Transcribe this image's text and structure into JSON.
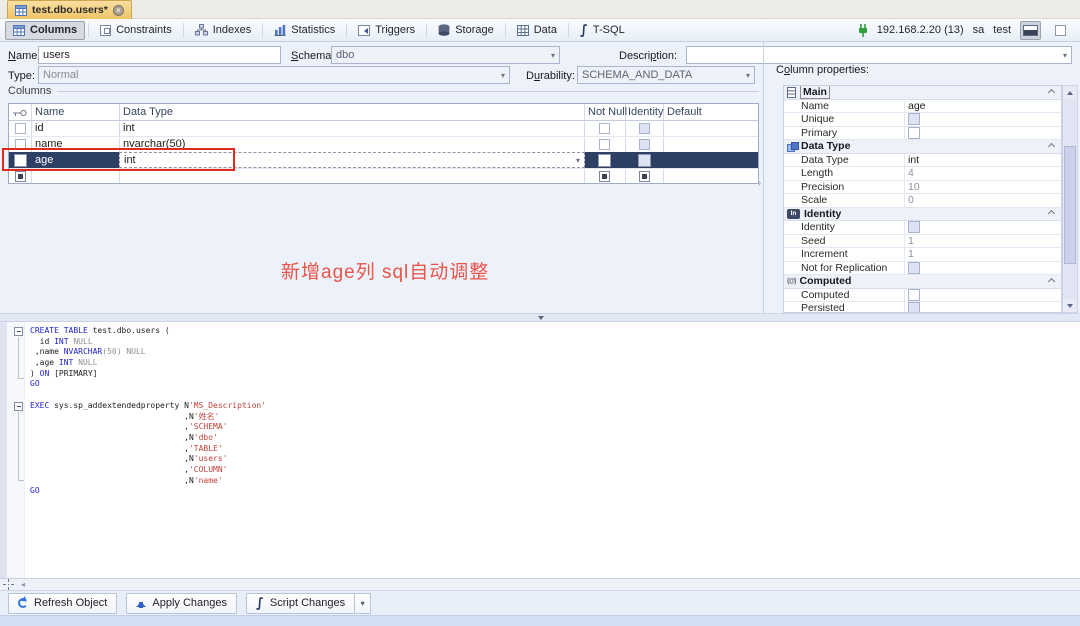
{
  "tab": {
    "title": "test.dbo.users*"
  },
  "toolbar": {
    "items": [
      "Columns",
      "Constraints",
      "Indexes",
      "Statistics",
      "Triggers",
      "Storage",
      "Data",
      "T-SQL"
    ]
  },
  "connection": {
    "host": "192.168.2.20 (13)",
    "user": "sa",
    "database": "test"
  },
  "form": {
    "name": {
      "pre": "",
      "u": "N",
      "post": "ame:",
      "value": "users"
    },
    "schema": {
      "pre": "",
      "u": "S",
      "post": "chema:",
      "value": "dbo"
    },
    "description": {
      "pre": "Descri",
      "u": "p",
      "post": "tion:",
      "value": ""
    },
    "type": {
      "label": "Type:",
      "value": "Normal"
    },
    "durability": {
      "pre": "D",
      "u": "u",
      "post": "rability:",
      "value": "SCHEMA_AND_DATA"
    }
  },
  "grid": {
    "group_label": "Columns",
    "headers": {
      "name": "Name",
      "data_type": "Data Type",
      "not_null": "Not Null",
      "identity": "Identity",
      "default": "Default"
    },
    "rows": [
      {
        "name": "id",
        "data_type": "int",
        "not_null": false,
        "identity": false,
        "default": ""
      },
      {
        "name": "name",
        "data_type": "nvarchar(50)",
        "not_null": false,
        "identity": false,
        "default": ""
      },
      {
        "name": "age",
        "data_type": "int",
        "not_null": false,
        "identity": false,
        "default": "",
        "selected": true
      }
    ]
  },
  "annotation": {
    "text": "新增age列 sql自动调整",
    "color": "#e8554b"
  },
  "props": {
    "title": {
      "pre": "C",
      "u": "o",
      "post": "lumn properties:"
    },
    "sections": {
      "main": {
        "label": "Main",
        "rows": [
          {
            "label": "Name",
            "value": "age"
          },
          {
            "label": "Unique",
            "checkbox": true,
            "state": "disabled"
          },
          {
            "label": "Primary",
            "checkbox": true,
            "state": "enabled"
          }
        ]
      },
      "data_type": {
        "label": "Data Type",
        "rows": [
          {
            "label": "Data Type",
            "value": "int"
          },
          {
            "label": "Length",
            "value": "4",
            "muted": true
          },
          {
            "label": "Precision",
            "value": "10",
            "muted": true
          },
          {
            "label": "Scale",
            "value": "0",
            "muted": true
          }
        ]
      },
      "identity": {
        "label": "Identity",
        "rows": [
          {
            "label": "Identity",
            "checkbox": true,
            "state": "disabled"
          },
          {
            "label": "Seed",
            "value": "1",
            "muted": true
          },
          {
            "label": "Increment",
            "value": "1",
            "muted": true
          },
          {
            "label": "Not for Replication",
            "checkbox": true,
            "state": "disabled"
          }
        ]
      },
      "computed": {
        "label": "Computed",
        "rows": [
          {
            "label": "Computed",
            "checkbox": true,
            "state": "enabled"
          },
          {
            "label": "Persisted",
            "checkbox": true,
            "state": "disabled"
          }
        ]
      }
    }
  },
  "sql": {
    "lines": [
      [
        [
          "k",
          "CREATE TABLE"
        ],
        [
          "p",
          " test.dbo.users ("
        ]
      ],
      [
        [
          "p",
          "  id "
        ],
        [
          "k",
          "INT"
        ],
        [
          "g",
          " NULL"
        ]
      ],
      [
        [
          "p",
          " ,name "
        ],
        [
          "k",
          "NVARCHAR"
        ],
        [
          "g",
          "(50) NULL"
        ]
      ],
      [
        [
          "p",
          " ,age "
        ],
        [
          "k",
          "INT"
        ],
        [
          "g",
          " NULL"
        ]
      ],
      [
        [
          "p",
          ") "
        ],
        [
          "k",
          "ON"
        ],
        [
          "p",
          " [PRIMARY]"
        ]
      ],
      [
        [
          "k",
          "GO"
        ]
      ],
      [
        [
          "p",
          ""
        ]
      ],
      [
        [
          "k",
          "EXEC"
        ],
        [
          "p",
          " sys.sp_addextendedproperty N"
        ],
        [
          "s",
          "'MS_Description'"
        ]
      ],
      [
        [
          "p",
          "                                ,N"
        ],
        [
          "s",
          "'姓名'"
        ]
      ],
      [
        [
          "p",
          "                                ,"
        ],
        [
          "s",
          "'SCHEMA'"
        ]
      ],
      [
        [
          "p",
          "                                ,N"
        ],
        [
          "s",
          "'dbo'"
        ]
      ],
      [
        [
          "p",
          "                                ,"
        ],
        [
          "s",
          "'TABLE'"
        ]
      ],
      [
        [
          "p",
          "                                ,N"
        ],
        [
          "s",
          "'users'"
        ]
      ],
      [
        [
          "p",
          "                                ,"
        ],
        [
          "s",
          "'COLUMN'"
        ]
      ],
      [
        [
          "p",
          "                                ,N"
        ],
        [
          "s",
          "'name'"
        ]
      ],
      [
        [
          "k",
          "GO"
        ]
      ]
    ]
  },
  "footer": {
    "refresh": "Refresh Object",
    "apply": "Apply Changes",
    "script": "Script Changes"
  },
  "icons": {
    "close": "×",
    "dropdown": "▾",
    "identity_badge": "In",
    "computed_badge": "(@)",
    "script_glyph": "∫",
    "vsplit": "›",
    "left_collapse": "◂"
  }
}
